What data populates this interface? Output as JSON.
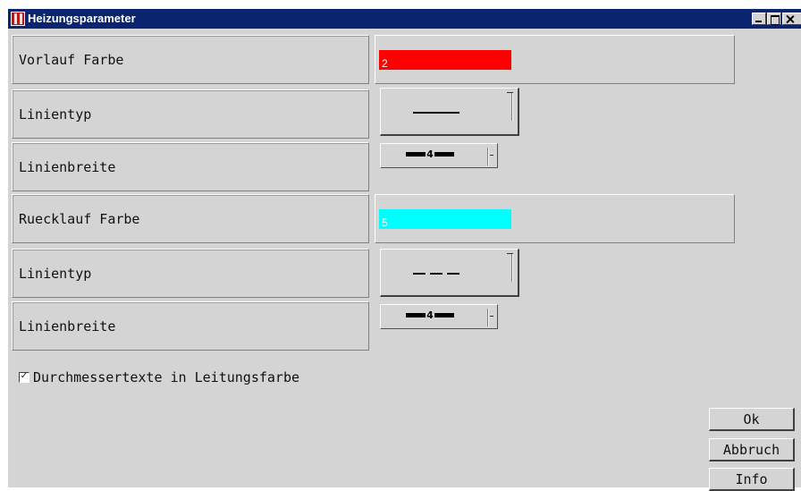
{
  "window": {
    "title": "Heizungsparameter"
  },
  "vorlauf": {
    "color_label": "Vorlauf Farbe",
    "color_value": "2",
    "color_hex": "#ff0000",
    "linetype_label": "Linientyp",
    "linetype_value": "solid",
    "linewidth_label": "Linienbreite",
    "linewidth_value": "4"
  },
  "ruecklauf": {
    "color_label": "Ruecklauf Farbe",
    "color_value": "5",
    "color_hex": "#00ffff",
    "linetype_label": "Linientyp",
    "linetype_value": "dashed",
    "linewidth_label": "Linienbreite",
    "linewidth_value": "4"
  },
  "options": {
    "durchmesser_label": "Durchmessertexte in Leitungsfarbe",
    "durchmesser_checked": true
  },
  "buttons": {
    "ok": "Ok",
    "abbruch": "Abbruch",
    "info": "Info"
  },
  "icons": {
    "window": "app-icon",
    "minimize": "minimize-icon",
    "maximize": "maximize-icon",
    "close": "close-icon",
    "check": "checkmark-icon"
  }
}
